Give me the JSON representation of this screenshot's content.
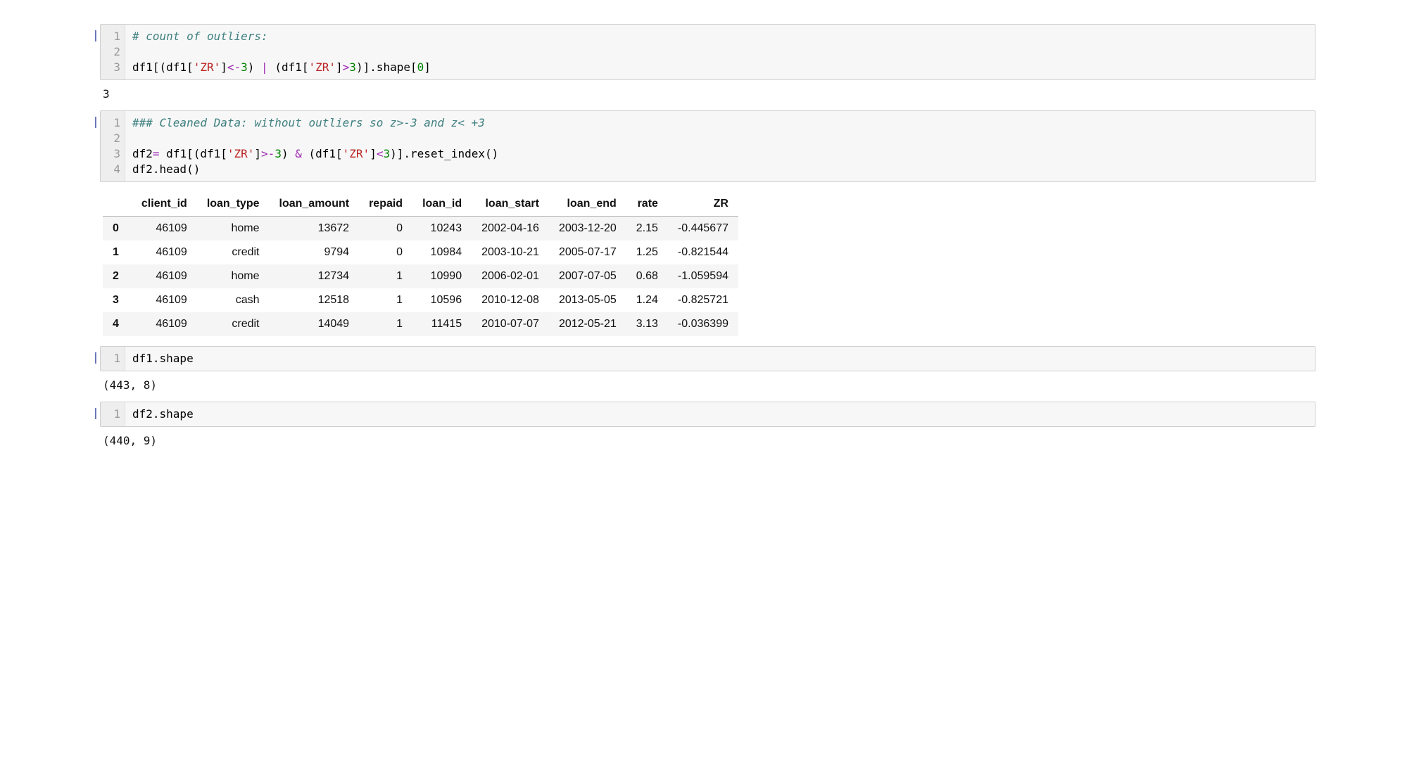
{
  "cells": [
    {
      "type": "code",
      "prompt": "|",
      "line_numbers": [
        "1",
        "2",
        "3"
      ],
      "tokens": [
        [
          {
            "t": "# count of outliers:",
            "c": "tok-comment"
          }
        ],
        [],
        [
          {
            "t": "df1[(df1[",
            "c": "tok-name"
          },
          {
            "t": "'ZR'",
            "c": "tok-str"
          },
          {
            "t": "]",
            "c": "tok-name"
          },
          {
            "t": "<-",
            "c": "tok-op"
          },
          {
            "t": "3",
            "c": "tok-num"
          },
          {
            "t": ") ",
            "c": "tok-name"
          },
          {
            "t": "|",
            "c": "tok-op"
          },
          {
            "t": " (df1[",
            "c": "tok-name"
          },
          {
            "t": "'ZR'",
            "c": "tok-str"
          },
          {
            "t": "]",
            "c": "tok-name"
          },
          {
            "t": ">",
            "c": "tok-op"
          },
          {
            "t": "3",
            "c": "tok-num"
          },
          {
            "t": ")].shape[",
            "c": "tok-name"
          },
          {
            "t": "0",
            "c": "tok-num"
          },
          {
            "t": "]",
            "c": "tok-name"
          }
        ]
      ],
      "output_text": "3"
    },
    {
      "type": "code",
      "prompt": "|",
      "line_numbers": [
        "1",
        "2",
        "3",
        "4"
      ],
      "tokens": [
        [
          {
            "t": "### Cleaned Data: without outliers so z>-3 and z< +3",
            "c": "tok-comment"
          }
        ],
        [],
        [
          {
            "t": "df2",
            "c": "tok-name"
          },
          {
            "t": "=",
            "c": "tok-op"
          },
          {
            "t": " df1[(df1[",
            "c": "tok-name"
          },
          {
            "t": "'ZR'",
            "c": "tok-str"
          },
          {
            "t": "]",
            "c": "tok-name"
          },
          {
            "t": ">-",
            "c": "tok-op"
          },
          {
            "t": "3",
            "c": "tok-num"
          },
          {
            "t": ") ",
            "c": "tok-name"
          },
          {
            "t": "&",
            "c": "tok-op"
          },
          {
            "t": " (df1[",
            "c": "tok-name"
          },
          {
            "t": "'ZR'",
            "c": "tok-str"
          },
          {
            "t": "]",
            "c": "tok-name"
          },
          {
            "t": "<",
            "c": "tok-op"
          },
          {
            "t": "3",
            "c": "tok-num"
          },
          {
            "t": ")].reset_index()",
            "c": "tok-name"
          }
        ],
        [
          {
            "t": "df2.head()",
            "c": "tok-name"
          }
        ]
      ],
      "output_table": {
        "columns": [
          "client_id",
          "loan_type",
          "loan_amount",
          "repaid",
          "loan_id",
          "loan_start",
          "loan_end",
          "rate",
          "ZR"
        ],
        "index": [
          "0",
          "1",
          "2",
          "3",
          "4"
        ],
        "rows": [
          [
            "46109",
            "home",
            "13672",
            "0",
            "10243",
            "2002-04-16",
            "2003-12-20",
            "2.15",
            "-0.445677"
          ],
          [
            "46109",
            "credit",
            "9794",
            "0",
            "10984",
            "2003-10-21",
            "2005-07-17",
            "1.25",
            "-0.821544"
          ],
          [
            "46109",
            "home",
            "12734",
            "1",
            "10990",
            "2006-02-01",
            "2007-07-05",
            "0.68",
            "-1.059594"
          ],
          [
            "46109",
            "cash",
            "12518",
            "1",
            "10596",
            "2010-12-08",
            "2013-05-05",
            "1.24",
            "-0.825721"
          ],
          [
            "46109",
            "credit",
            "14049",
            "1",
            "11415",
            "2010-07-07",
            "2012-05-21",
            "3.13",
            "-0.036399"
          ]
        ]
      }
    },
    {
      "type": "code",
      "prompt": "|",
      "line_numbers": [
        "1"
      ],
      "tokens": [
        [
          {
            "t": "df1.shape",
            "c": "tok-name"
          }
        ]
      ],
      "output_text": "(443, 8)"
    },
    {
      "type": "code",
      "prompt": "|",
      "line_numbers": [
        "1"
      ],
      "tokens": [
        [
          {
            "t": "df2.shape",
            "c": "tok-name"
          }
        ]
      ],
      "output_text": "(440, 9)"
    }
  ]
}
